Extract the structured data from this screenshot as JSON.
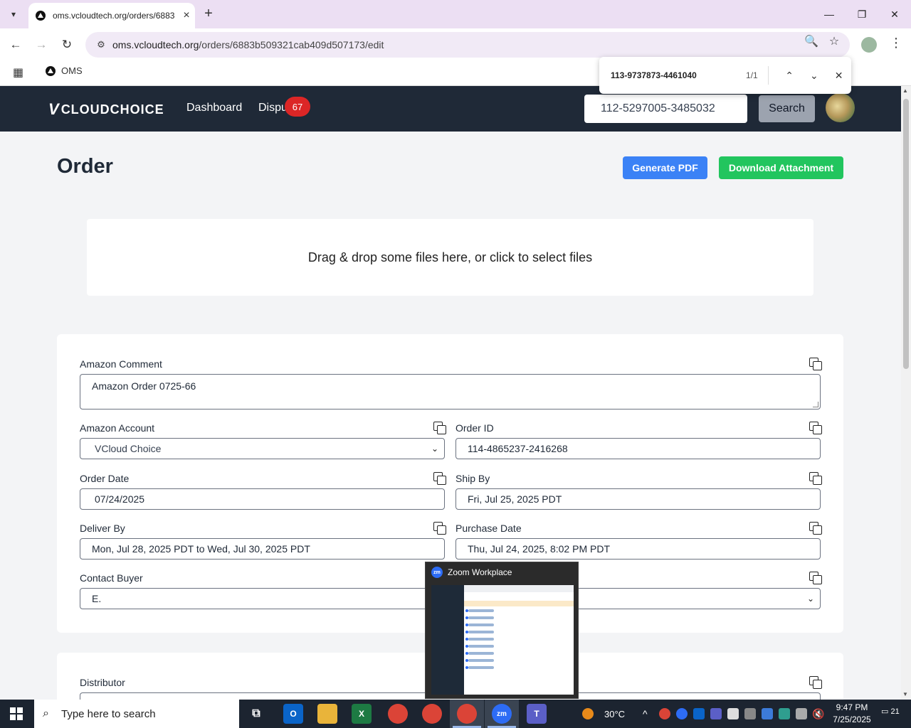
{
  "browser": {
    "tab_title": "oms.vcloudtech.org/orders/6883",
    "url_host": "oms.vcloudtech.org",
    "url_path": "/orders/6883b509321cab409d507173/edit",
    "bookmark_label": "OMS",
    "find": {
      "query": "113-9737873-4461040",
      "count": "1/1"
    }
  },
  "navbar": {
    "logo_text": "CLOUDCHOICE",
    "links": [
      "Dashboard",
      "Dispu"
    ],
    "disputes_badge": "67",
    "search_value": "112-5297005-3485032",
    "search_button": "Search"
  },
  "page": {
    "title": "Order",
    "generate_pdf": "Generate PDF",
    "download_attachment": "Download Attachment",
    "dropzone_text": "Drag & drop some files here, or click to select files"
  },
  "form": {
    "amazon_comment": {
      "label": "Amazon Comment",
      "value": "Amazon Order 0725-66"
    },
    "amazon_account": {
      "label": "Amazon Account",
      "value": "VCloud Choice"
    },
    "order_id": {
      "label": "Order ID",
      "value": "114-4865237-2416268"
    },
    "order_date": {
      "label": "Order Date",
      "value": "07/24/2025"
    },
    "ship_by": {
      "label": "Ship By",
      "value": "Fri, Jul 25, 2025 PDT"
    },
    "deliver_by": {
      "label": "Deliver By",
      "value": "Mon, Jul 28, 2025 PDT to Wed, Jul 30, 2025 PDT"
    },
    "purchase_date": {
      "label": "Purchase Date",
      "value": "Thu, Jul 24, 2025, 8:02 PM PDT"
    },
    "contact_buyer": {
      "label": "Contact Buyer",
      "value": "E."
    },
    "distributor": {
      "label": "Distributor"
    }
  },
  "zoom_popup": {
    "title": "Zoom Workplace",
    "logo": "zm"
  },
  "taskbar": {
    "search_placeholder": "Type here to search",
    "weather": "30°C",
    "time": "9:47 PM",
    "date": "7/25/2025",
    "notifications": "21"
  },
  "colors": {
    "navbar": "#1f2937",
    "primary_blue": "#3b82f6",
    "success_green": "#22c55e",
    "badge_red": "#dc2626"
  }
}
